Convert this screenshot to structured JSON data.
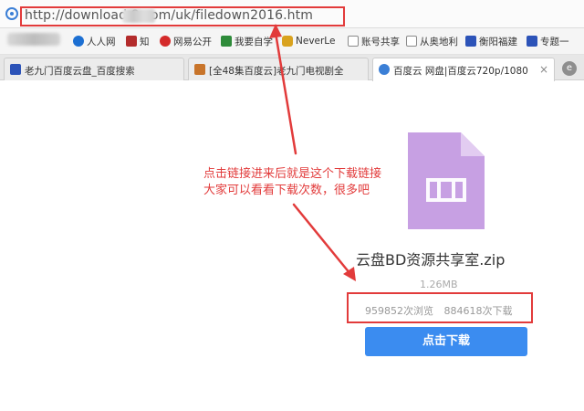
{
  "address_bar": {
    "url": "http://download     8.com/uk/filedown2016.htm"
  },
  "bookmarks": [
    {
      "label": "人人网",
      "icon": "renren-icon",
      "color": "#1c6fd2"
    },
    {
      "label": "知",
      "icon": "zhihu-icon",
      "color": "#b32b2b"
    },
    {
      "label": "网易公开",
      "icon": "netease-icon",
      "color": "#d42a2a"
    },
    {
      "label": "我要自学",
      "icon": "zixue-icon",
      "color": "#2e8b3a"
    },
    {
      "label": "NeverLe",
      "icon": "neverle-icon",
      "color": "#d9a21e"
    },
    {
      "label": "账号共享",
      "icon": "doc-icon",
      "color": "#8a8a8a"
    },
    {
      "label": "从奥地利",
      "icon": "doc-icon",
      "color": "#8a8a8a"
    },
    {
      "label": "衡阳福建",
      "icon": "paw-icon",
      "color": "#2c53b8"
    },
    {
      "label": "专题一",
      "icon": "paw-icon",
      "color": "#2c53b8"
    }
  ],
  "tabs": [
    {
      "label": "老九门百度云盘_百度搜索",
      "icon": "baidu-paw-icon",
      "active": false
    },
    {
      "label": "[全48集百度云]老九门电视剧全",
      "icon": "site-icon",
      "active": false
    },
    {
      "label": "百度云 网盘|百度云720p/1080",
      "icon": "baidu-cloud-icon",
      "active": true
    }
  ],
  "annotation": {
    "line1": "点击链接进来后就是这个下载链接",
    "line2": "大家可以看看下载次数，很多吧"
  },
  "file": {
    "name": "云盘BD资源共享室.zip",
    "size": "1.26MB",
    "views": "959852次浏览",
    "downloads": "884618次下载",
    "download_label": "点击下载"
  },
  "colors": {
    "highlight": "#e23b3b",
    "file_icon": "#c7a0e3",
    "button": "#3b8cf0"
  }
}
